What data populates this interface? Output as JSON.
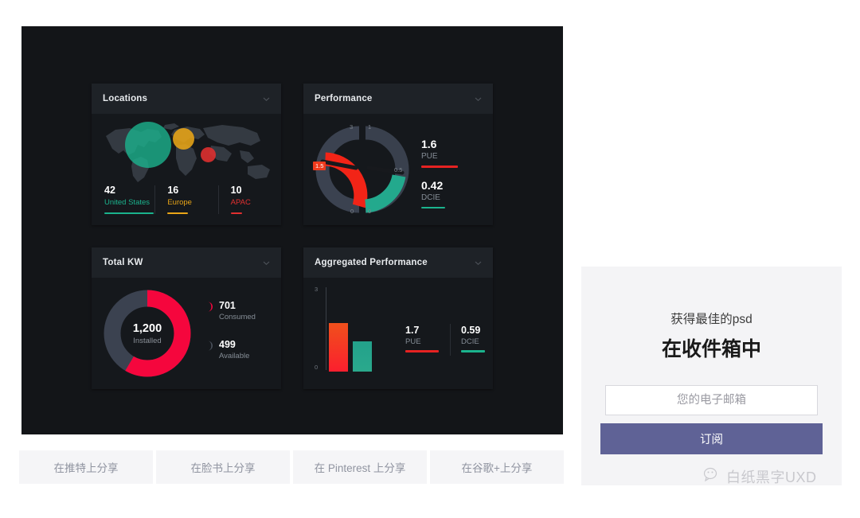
{
  "dashboard": {
    "cards": [
      {
        "title": "Locations",
        "menu_icon": "chevron-down-icon",
        "stats": [
          {
            "value": "42",
            "label": "United States",
            "color": "#1bb38d"
          },
          {
            "value": "16",
            "label": "Europe",
            "color": "#e9a517"
          },
          {
            "value": "10",
            "label": "APAC",
            "color": "#e23030"
          }
        ]
      },
      {
        "title": "Performance",
        "menu_icon": "chevron-down-icon",
        "gauges": {
          "left": {
            "ticks": [
              "3",
              "1.5",
              "0"
            ],
            "active_tick": "1.5",
            "color": "#f22417"
          },
          "right": {
            "ticks": [
              "1",
              "0.5",
              "0"
            ],
            "color": "#23a98d"
          }
        },
        "readouts": [
          {
            "value": "1.6",
            "label": "PUE",
            "color": "#e62222"
          },
          {
            "value": "0.42",
            "label": "DCIE",
            "color": "#1bb38d"
          }
        ]
      },
      {
        "title": "Total KW",
        "menu_icon": "chevron-down-icon",
        "donut": {
          "center_value": "1,200",
          "center_label": "Installed"
        },
        "legend": [
          {
            "value": "701",
            "label": "Consumed",
            "color": "#f5063d"
          },
          {
            "value": "499",
            "label": "Available",
            "color": "#3b4250"
          }
        ]
      },
      {
        "title": "Aggregated Performance",
        "menu_icon": "chevron-down-icon",
        "axis": {
          "top": "3",
          "bottom": "0"
        },
        "readouts": [
          {
            "value": "1.7",
            "label": "PUE",
            "color": "#e62222"
          },
          {
            "value": "0.59",
            "label": "DCIE",
            "color": "#1bb38d"
          }
        ]
      }
    ]
  },
  "chart_data": [
    {
      "type": "bar",
      "title": "Locations",
      "categories": [
        "United States",
        "Europe",
        "APAC"
      ],
      "values": [
        42,
        16,
        10
      ],
      "colors": [
        "#1bb38d",
        "#e9a517",
        "#e23030"
      ],
      "xlabel": "",
      "ylabel": "",
      "legend": "inline"
    },
    {
      "type": "gauge",
      "title": "Performance",
      "series": [
        {
          "name": "PUE",
          "value": 1.6,
          "min": 0,
          "max": 3,
          "ticks": [
            0,
            1.5,
            3
          ],
          "color": "#f22417"
        },
        {
          "name": "DCIE",
          "value": 0.42,
          "min": 0,
          "max": 1,
          "ticks": [
            0,
            0.5,
            1
          ],
          "color": "#23a98d"
        }
      ]
    },
    {
      "type": "pie",
      "title": "Total KW",
      "subtitle": "1,200 Installed",
      "categories": [
        "Consumed",
        "Available"
      ],
      "values": [
        701,
        499
      ],
      "colors": [
        "#f5063d",
        "#3b4250"
      ],
      "total": 1200
    },
    {
      "type": "bar",
      "title": "Aggregated Performance",
      "categories": [
        "PUE",
        "DCIE"
      ],
      "values": [
        1.7,
        0.59
      ],
      "bar_heights": [
        1.7,
        1.05
      ],
      "colors": [
        "#f5222d",
        "#26a58c"
      ],
      "ylim": [
        0,
        3
      ],
      "yticks": [
        "0",
        "3"
      ],
      "grid": false
    }
  ],
  "share": {
    "buttons": [
      {
        "label": "在推特上分享"
      },
      {
        "label": "在脸书上分享"
      },
      {
        "label": "在 Pinterest 上分享"
      },
      {
        "label": "在谷歌+上分享"
      }
    ]
  },
  "subscribe": {
    "eyebrow": "获得最佳的psd",
    "heading": "在收件箱中",
    "email_placeholder": "您的电子邮箱",
    "email_value": "",
    "button_label": "订阅",
    "accent_color": "#5f6296"
  },
  "watermark": {
    "icon": "wechat-icon",
    "text": "白纸黑字UXD"
  }
}
